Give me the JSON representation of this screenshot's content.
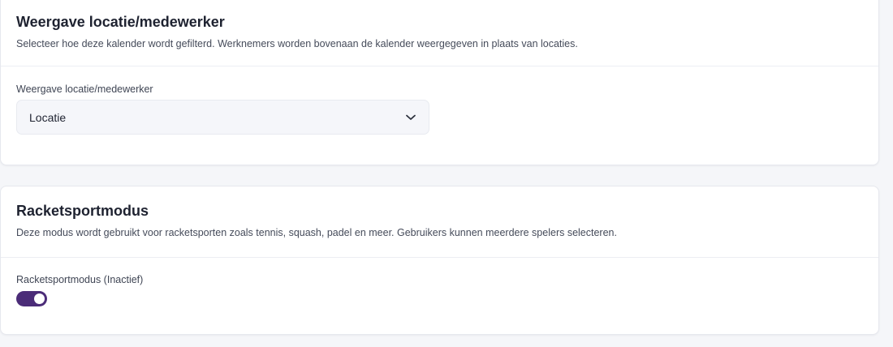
{
  "display_section": {
    "title": "Weergave locatie/medewerker",
    "description": "Selecteer hoe deze kalender wordt gefilterd. Werknemers worden bovenaan de kalender weergegeven in plaats van locaties.",
    "field_label": "Weergave locatie/medewerker",
    "select_value": "Locatie",
    "select_icon": "chevron-down-icon"
  },
  "racket_section": {
    "title": "Racketsportmodus",
    "description": "Deze modus wordt gebruikt voor racketsporten zoals tennis, squash, padel en meer. Gebruikers kunnen meerdere spelers selecteren.",
    "toggle_label": "Racketsportmodus (Inactief)",
    "toggle_on": true
  },
  "colors": {
    "accent": "#4b2c78",
    "page_background": "#f5f6f9",
    "card_background": "#ffffff"
  }
}
